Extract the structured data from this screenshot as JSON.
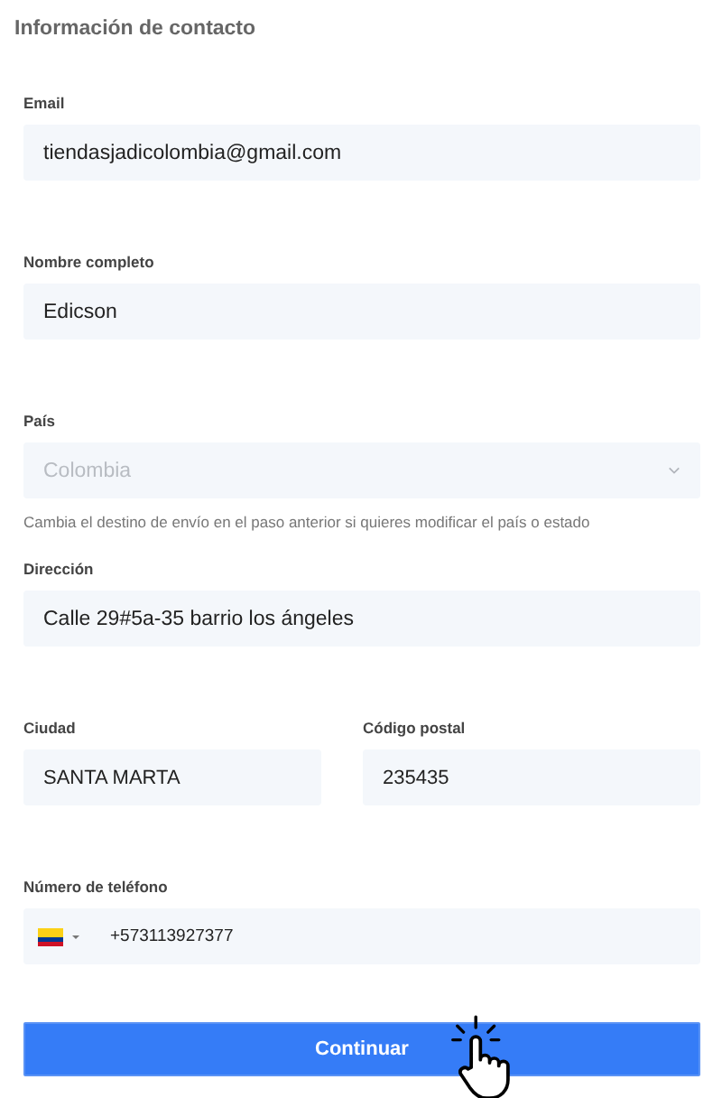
{
  "section_title": "Información de contacto",
  "fields": [
    {
      "kind": "text",
      "label": "Email",
      "value": "tiendasjadicolombia@gmail.com"
    },
    {
      "kind": "text",
      "label": "Nombre completo",
      "value": "Edicson"
    },
    {
      "kind": "select",
      "label": "País",
      "value": "Colombia",
      "disabled": true,
      "hint": "Cambia el destino de envío en el paso anterior si quieres modificar el país o estado"
    },
    {
      "kind": "text",
      "label": "Dirección",
      "value": "Calle 29#5a-35 barrio los ángeles"
    },
    {
      "kind": "pair",
      "items": [
        {
          "label": "Ciudad",
          "value": "SANTA MARTA"
        },
        {
          "label": "Código postal",
          "value": "235435"
        }
      ]
    },
    {
      "kind": "phone",
      "label": "Número de teléfono",
      "value": "+573113927377"
    }
  ],
  "submit": {
    "label": "Continuar"
  }
}
